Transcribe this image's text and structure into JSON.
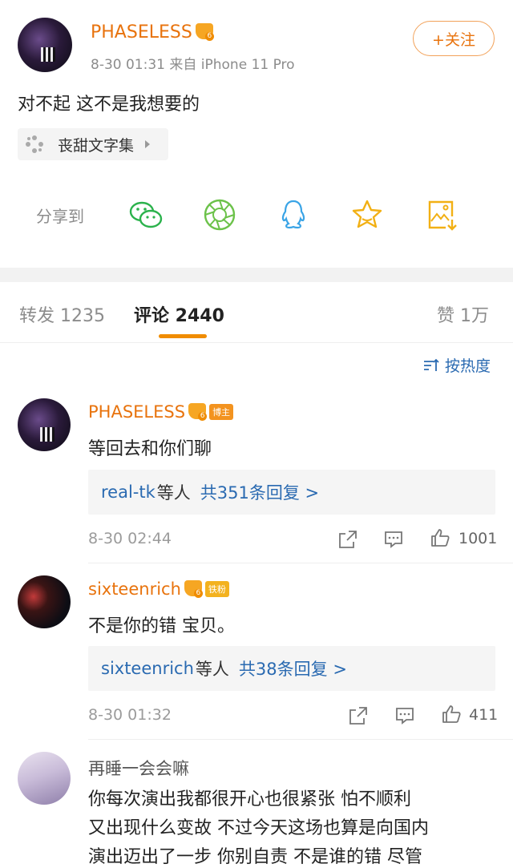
{
  "post": {
    "username": "PHASELESS",
    "meta": "8-30 01:31  来自 iPhone 11 Pro",
    "follow_label": "+关注",
    "text": "对不起 这不是我想要的",
    "topic_label": "丧甜文字集"
  },
  "share": {
    "label": "分享到",
    "targets": [
      "wechat-icon",
      "moments-icon",
      "qq-icon",
      "favorites-icon",
      "save-image-icon"
    ]
  },
  "tabs": {
    "reposts": "转发 1235",
    "comments": "评论 2440",
    "likes": "赞 1万"
  },
  "sort_label": "按热度",
  "comments": [
    {
      "username": "PHASELESS",
      "badge": "博主",
      "text": "等回去和你们聊",
      "reply_users": "real-tk",
      "reply_suffix": "等人",
      "reply_count": "共351条回复 >",
      "time": "8-30 02:44",
      "likes": "1001"
    },
    {
      "username": "sixteenrich",
      "badge": "铁粉",
      "text": "不是你的错 宝贝。",
      "reply_users": "sixteenrich",
      "reply_suffix": "等人",
      "reply_count": "共38条回复 >",
      "time": "8-30 01:32",
      "likes": "411"
    },
    {
      "username": "再睡一会会嘛",
      "lines": [
        "你每次演出我都很开心也很紧张 怕不顺利",
        "又出现什么变故 不过今天这场也算是向国内",
        "演出迈出了一步 你别自责 不是谁的错 尽管"
      ]
    }
  ],
  "colors": {
    "accent_orange": "#e8730d",
    "link_blue": "#2a6ab1",
    "tab_underline": "#f08c00"
  }
}
